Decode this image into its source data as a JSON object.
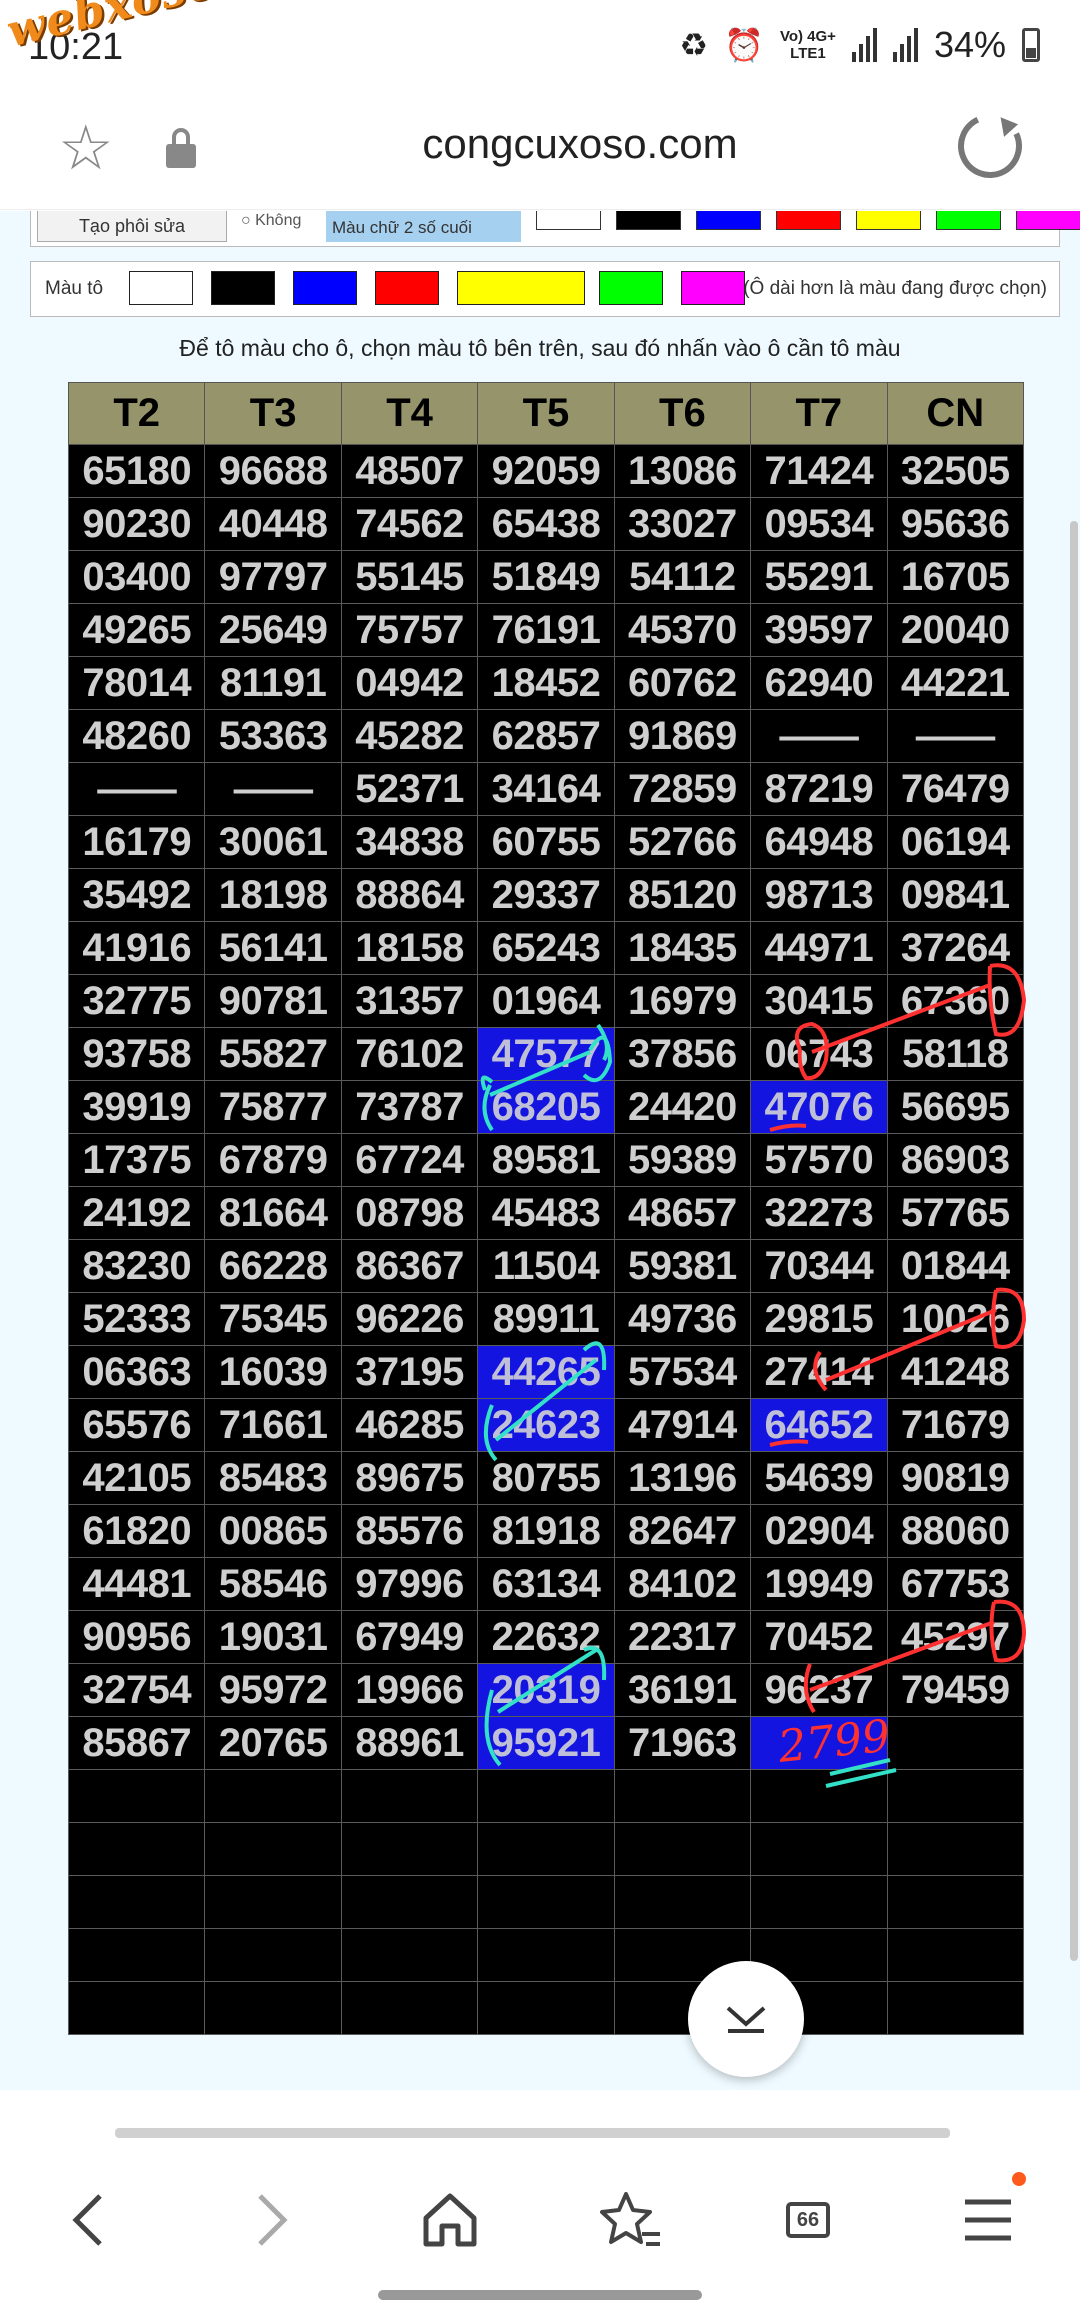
{
  "status_bar": {
    "time": "10:21",
    "watermark": "webxoso.net",
    "network_label": "Vo) 4G+\nLTE1",
    "battery": "34%"
  },
  "browser": {
    "url": "congcuxoso.com"
  },
  "toolbar": {
    "button_partial": "Tạo phôi sửa",
    "radio_partial": "Không",
    "select_partial": "Màu chữ 2 số cuối",
    "paint_label": "Màu tô",
    "paint_note": "(Ô dài hơn là màu đang được chọn)",
    "swatches": [
      "#ffffff",
      "#000000",
      "#0000ff",
      "#ff0000",
      "#ffff00",
      "#00ff00",
      "#ff00ff"
    ],
    "selected_swatch": "#ffff00"
  },
  "instruction": "Để tô màu cho ô, chọn màu tô bên trên, sau đó nhấn vào ô cần tô màu",
  "table": {
    "headers": [
      "T2",
      "T3",
      "T4",
      "T5",
      "T6",
      "T7",
      "CN"
    ],
    "rows": [
      [
        "65180",
        "96688",
        "48507",
        "92059",
        "13086",
        "71424",
        "32505"
      ],
      [
        "90230",
        "40448",
        "74562",
        "65438",
        "33027",
        "09534",
        "95636"
      ],
      [
        "03400",
        "97797",
        "55145",
        "51849",
        "54112",
        "55291",
        "16705"
      ],
      [
        "49265",
        "25649",
        "75757",
        "76191",
        "45370",
        "39597",
        "20040"
      ],
      [
        "78014",
        "81191",
        "04942",
        "18452",
        "60762",
        "62940",
        "44221"
      ],
      [
        "48260",
        "53363",
        "45282",
        "62857",
        "91869",
        "——",
        "——"
      ],
      [
        "——",
        "——",
        "52371",
        "34164",
        "72859",
        "87219",
        "76479"
      ],
      [
        "16179",
        "30061",
        "34838",
        "60755",
        "52766",
        "64948",
        "06194"
      ],
      [
        "35492",
        "18198",
        "88864",
        "29337",
        "85120",
        "98713",
        "09841"
      ],
      [
        "41916",
        "56141",
        "18158",
        "65243",
        "18435",
        "44971",
        "37264"
      ],
      [
        "32775",
        "90781",
        "31357",
        "01964",
        "16979",
        "30415",
        "67360"
      ],
      [
        "93758",
        "55827",
        "76102",
        "47577",
        "37856",
        "06743",
        "58118"
      ],
      [
        "39919",
        "75877",
        "73787",
        "68205",
        "24420",
        "47076",
        "56695"
      ],
      [
        "17375",
        "67879",
        "67724",
        "89581",
        "59389",
        "57570",
        "86903"
      ],
      [
        "24192",
        "81664",
        "08798",
        "45483",
        "48657",
        "32273",
        "57765"
      ],
      [
        "83230",
        "66228",
        "86367",
        "11504",
        "59381",
        "70344",
        "01844"
      ],
      [
        "52333",
        "75345",
        "96226",
        "89911",
        "49736",
        "29815",
        "10026"
      ],
      [
        "06363",
        "16039",
        "37195",
        "44265",
        "57534",
        "27414",
        "41248"
      ],
      [
        "65576",
        "71661",
        "46285",
        "24623",
        "47914",
        "64652",
        "71679"
      ],
      [
        "42105",
        "85483",
        "89675",
        "80755",
        "13196",
        "54639",
        "90819"
      ],
      [
        "61820",
        "00865",
        "85576",
        "81918",
        "82647",
        "02904",
        "88060"
      ],
      [
        "44481",
        "58546",
        "97996",
        "63134",
        "84102",
        "19949",
        "67753"
      ],
      [
        "90956",
        "19031",
        "67949",
        "22632",
        "22317",
        "70452",
        "45297"
      ],
      [
        "32754",
        "95972",
        "19966",
        "20319",
        "36191",
        "96237",
        "79459"
      ],
      [
        "85867",
        "20765",
        "88961",
        "95921",
        "71963",
        "",
        ""
      ],
      [
        "",
        "",
        "",
        "",
        "",
        "",
        ""
      ],
      [
        "",
        "",
        "",
        "",
        "",
        "",
        ""
      ],
      [
        "",
        "",
        "",
        "",
        "",
        "",
        ""
      ],
      [
        "",
        "",
        "",
        "",
        "",
        "",
        ""
      ],
      [
        "",
        "",
        "",
        "",
        "",
        "",
        ""
      ]
    ],
    "highlighted_cells": [
      [
        11,
        3
      ],
      [
        12,
        3
      ],
      [
        12,
        5
      ],
      [
        17,
        3
      ],
      [
        18,
        3
      ],
      [
        18,
        5
      ],
      [
        23,
        3
      ],
      [
        24,
        3
      ],
      [
        24,
        5
      ]
    ],
    "highlight_color": "#1414e0"
  },
  "annotations": {
    "handwritten_text": "2799"
  },
  "bottom_nav": {
    "tab_count": "66"
  }
}
